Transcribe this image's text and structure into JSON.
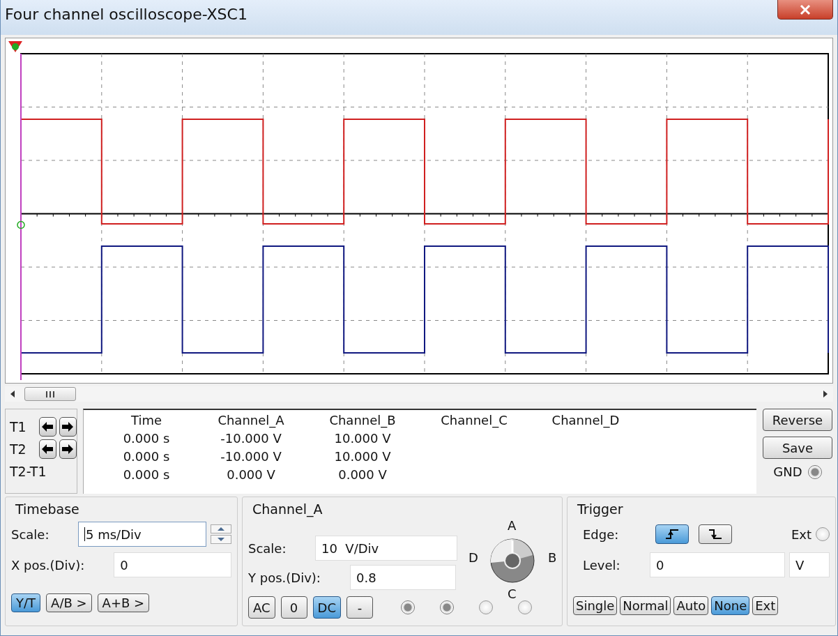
{
  "window": {
    "title": "Four channel oscilloscope-XSC1"
  },
  "cursors": [
    {
      "label": "T1"
    },
    {
      "label": "T2"
    }
  ],
  "diff_label": "T2-T1",
  "readout": {
    "columns": [
      "Time",
      "Channel_A",
      "Channel_B",
      "Channel_C",
      "Channel_D"
    ],
    "rows": [
      [
        "0.000 s",
        "-10.000 V",
        "10.000 V"
      ],
      [
        "0.000 s",
        "-10.000 V",
        "10.000 V"
      ],
      [
        "0.000 s",
        "0.000 V",
        "0.000 V"
      ]
    ]
  },
  "side_buttons": [
    "Reverse",
    "Save"
  ],
  "gnd": {
    "label": "GND"
  },
  "timebase": {
    "title": "Timebase",
    "scale_label": "Scale:",
    "scale": "5 ms/Div",
    "xpos_label": "X pos.(Div):",
    "xpos": "0",
    "modes": [
      {
        "label": "Y/T",
        "selected": true
      },
      {
        "label": "A/B >",
        "selected": false
      },
      {
        "label": "A+B >",
        "selected": false
      }
    ]
  },
  "channel": {
    "title": "Channel_A",
    "scale_label": "Scale:",
    "scale": "10  V/Div",
    "ypos_label": "Y pos.(Div):",
    "ypos": "0.8",
    "coupling": [
      {
        "label": "AC",
        "selected": false
      },
      {
        "label": "0",
        "selected": false
      },
      {
        "label": "DC",
        "selected": true
      },
      {
        "label": "-",
        "selected": false
      }
    ],
    "knob_labels": [
      "A",
      "B",
      "C",
      "D"
    ],
    "radios": [
      {
        "on": true
      },
      {
        "on": true
      },
      {
        "on": false
      },
      {
        "on": false
      }
    ]
  },
  "trigger": {
    "title": "Trigger",
    "edge_label": "Edge:",
    "edges": [
      {
        "kind": "rising",
        "selected": true
      },
      {
        "kind": "falling",
        "selected": false
      }
    ],
    "ext_label": "Ext",
    "ext": {
      "on": false
    },
    "level_label": "Level:",
    "level": "0",
    "unit": "V",
    "modes": [
      {
        "label": "Single",
        "selected": false
      },
      {
        "label": "Normal",
        "selected": false
      },
      {
        "label": "Auto",
        "selected": false
      },
      {
        "label": "None",
        "selected": true
      },
      {
        "label": "Ext",
        "selected": false
      }
    ]
  }
}
